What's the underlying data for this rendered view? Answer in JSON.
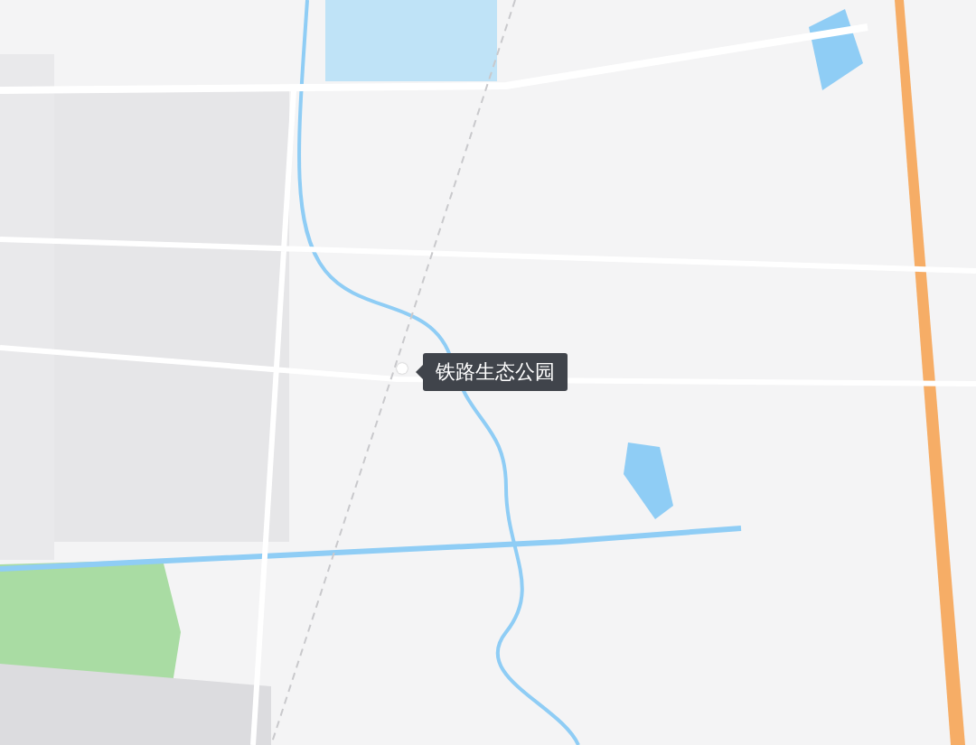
{
  "marker": {
    "label": "铁路生态公园"
  }
}
